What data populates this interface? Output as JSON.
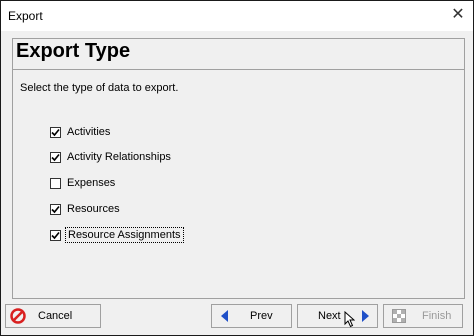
{
  "window": {
    "title": "Export",
    "close_glyph": "✕"
  },
  "page": {
    "heading": "Export Type",
    "description": "Select the type of data to export."
  },
  "options": [
    {
      "label": "Activities",
      "checked": true
    },
    {
      "label": "Activity Relationships",
      "checked": true
    },
    {
      "label": "Expenses",
      "checked": false
    },
    {
      "label": "Resources",
      "checked": true
    },
    {
      "label": "Resource Assignments",
      "checked": true
    }
  ],
  "buttons": {
    "cancel": {
      "label": "Cancel",
      "icon": "cancel-icon"
    },
    "prev": {
      "label": "Prev",
      "icon": "arrow-left-icon"
    },
    "next": {
      "label": "Next",
      "icon": "arrow-right-icon"
    },
    "finish": {
      "label": "Finish",
      "icon": "finish-flag-icon",
      "enabled": false
    }
  },
  "colors": {
    "arrow_blue": "#2050c8",
    "cancel_red": "#d92020"
  }
}
